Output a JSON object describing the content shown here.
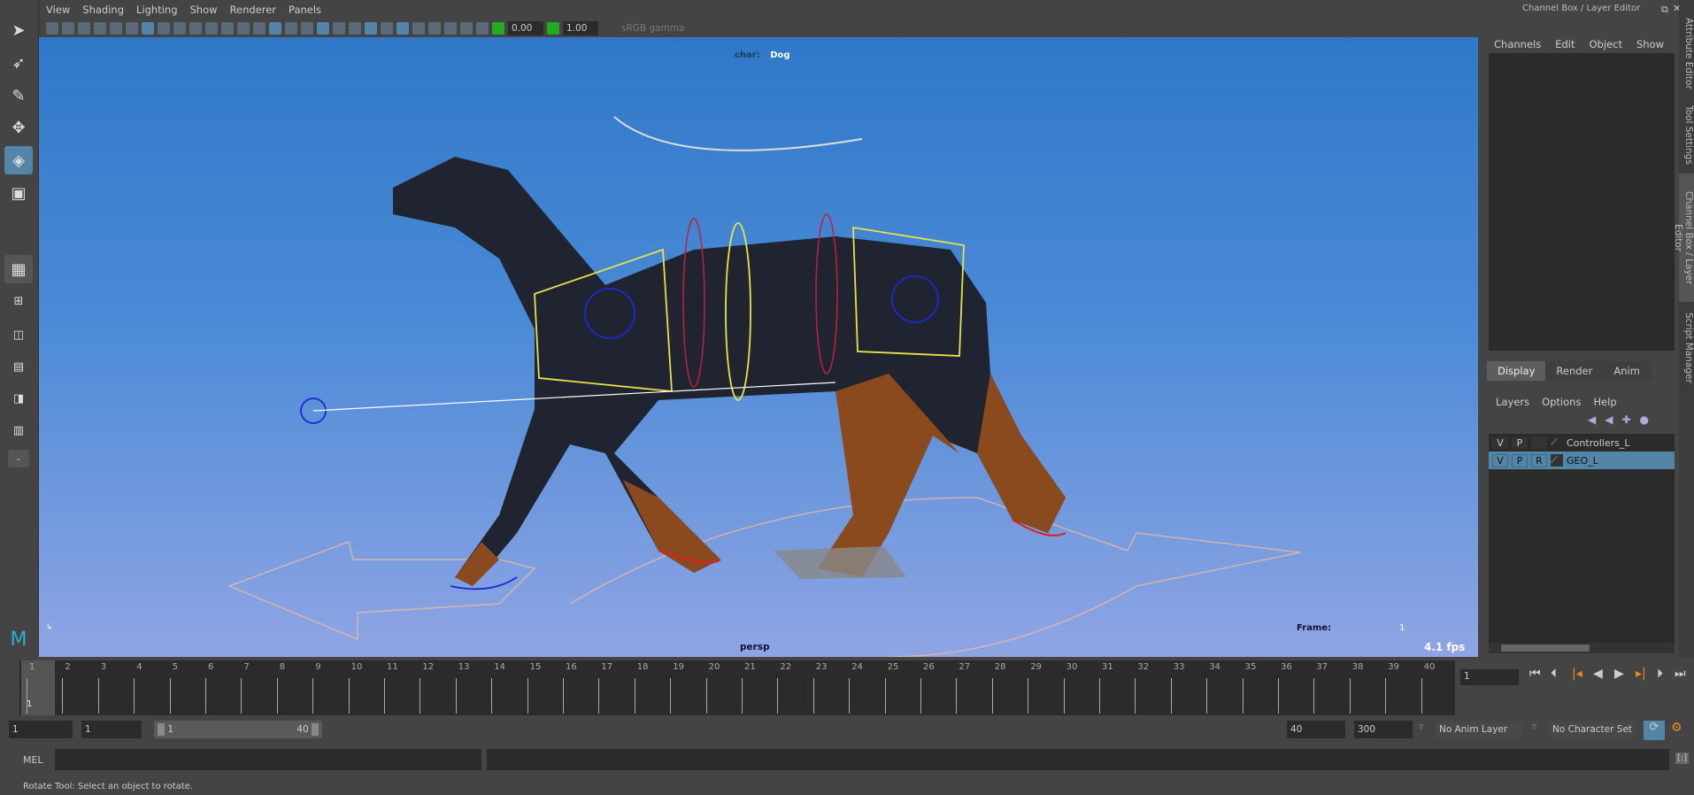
{
  "viewport_menu": [
    "View",
    "Shading",
    "Lighting",
    "Show",
    "Renderer",
    "Panels"
  ],
  "toolbar": {
    "gamma_min": "0.00",
    "gamma_max": "1.00",
    "color_space": "sRGB gamma"
  },
  "viewport": {
    "char_label": "char:",
    "char_value": "Dog",
    "camera": "persp",
    "frame_label": "Frame:",
    "frame_value": "1",
    "fps": "4.1 fps"
  },
  "channel_box": {
    "title": "Channel Box / Layer Editor",
    "menus": [
      "Channels",
      "Edit",
      "Object",
      "Show"
    ]
  },
  "layer_editor": {
    "tabs": [
      "Display",
      "Render",
      "Anim"
    ],
    "active_tab": "Display",
    "menus": [
      "Layers",
      "Options",
      "Help"
    ],
    "layers": [
      {
        "v": "V",
        "p": "P",
        "r": "",
        "name": "Controllers_L",
        "selected": false
      },
      {
        "v": "V",
        "p": "P",
        "r": "R",
        "name": "GEO_L",
        "selected": true
      }
    ]
  },
  "side_tabs": [
    "Attribute Editor",
    "Tool Settings",
    "Channel Box / Layer Editor",
    "Script Manager"
  ],
  "timeline": {
    "start": 1,
    "end": 40,
    "current": 1,
    "current_label": "1"
  },
  "playback": {
    "current_frame": "1"
  },
  "range": {
    "start": "1",
    "playback_start": "1",
    "slider_start": "1",
    "slider_end": "40",
    "playback_end": "40",
    "end": "300",
    "anim_layer": "No Anim Layer",
    "character_set": "No Character Set"
  },
  "command_line": {
    "label": "MEL"
  },
  "status_line": "Rotate Tool: Select an object to rotate.",
  "colors": {
    "accent": "#5285a6",
    "viewport_top": "#2f78c8",
    "viewport_bottom": "#8fa5e4",
    "key_marker": "#e8882a"
  }
}
